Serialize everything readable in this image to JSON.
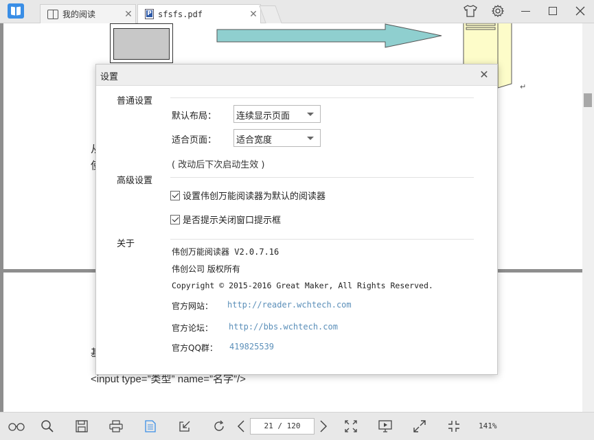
{
  "titlebar": {
    "tabs": [
      {
        "label": "我的阅读",
        "icon": "book-icon"
      },
      {
        "label": "sfsfs.pdf",
        "icon": "pdf-file-icon"
      }
    ],
    "buttons": [
      "skin-icon",
      "gear-icon",
      "minimize-icon",
      "maximize-icon",
      "close-icon"
    ]
  },
  "document": {
    "page1_text": [
      "从",
      "使"
    ],
    "page2_text": [
      "基",
      "<input type=”类型” name=”名字”/>"
    ],
    "para_mark": "↵"
  },
  "dialog": {
    "title": "设置",
    "general": {
      "title": "普通设置",
      "layout_label": "默认布局：",
      "layout_value": "连续显示页面",
      "fit_label": "适合页面：",
      "fit_value": "适合宽度",
      "note": "( 改动后下次启动生效 )"
    },
    "advanced": {
      "title": "高级设置",
      "options": [
        {
          "label": "设置伟创万能阅读器为默认的阅读器",
          "checked": true
        },
        {
          "label": "是否提示关闭窗口提示框",
          "checked": true
        }
      ]
    },
    "about": {
      "title": "关于",
      "product": "伟创万能阅读器 V2.0.7.16",
      "company": "伟创公司 版权所有",
      "copyright": "Copyright © 2015-2016 Great Maker, All Rights Reserved.",
      "website_label": "官方网站：",
      "website_url": "http://reader.wchtech.com",
      "forum_label": "官方论坛：",
      "forum_url": "http://bbs.wchtech.com",
      "qq_label": "官方QQ群：",
      "qq_value": "419825539"
    }
  },
  "toolbar": {
    "page_indicator": "21 / 120",
    "zoom": "141%"
  },
  "colors": {
    "accent": "#3a8ee6",
    "link": "#5b8fb9",
    "arrow_fill": "#8fcfcf",
    "server_fill": "#fdfcc9"
  }
}
